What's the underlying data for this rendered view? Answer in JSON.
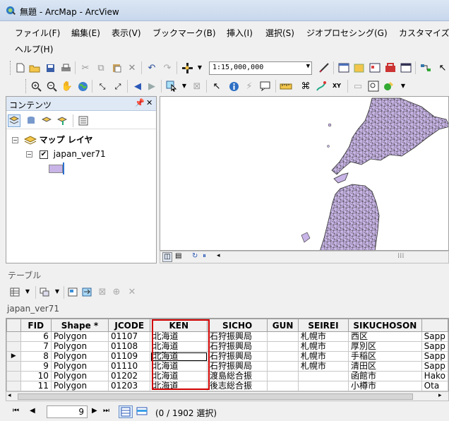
{
  "window": {
    "title": "無題 - ArcMap - ArcView"
  },
  "menu": [
    {
      "label": "ファイル(F)"
    },
    {
      "label": "編集(E)"
    },
    {
      "label": "表示(V)"
    },
    {
      "label": "ブックマーク(B)"
    },
    {
      "label": "挿入(I)"
    },
    {
      "label": "選択(S)"
    },
    {
      "label": "ジオプロセシング(G)"
    },
    {
      "label": "カスタマイズ"
    },
    {
      "label": "ヘルプ(H)"
    }
  ],
  "toolbar": {
    "scale_value": "1:15,000,000"
  },
  "contents": {
    "title": "コンテンツ",
    "pin_icon": "pin-icon",
    "close_icon": "close-icon",
    "layers_group": "マップ レイヤ",
    "layer_name": "japan_ver71",
    "layer_visible": true,
    "symbol_color": "#c8b4e6"
  },
  "map": {
    "fill_color": "#c8b4e6",
    "stroke_color": "#333333"
  },
  "table": {
    "panel_title": "テーブル",
    "layer_name": "japan_ver71",
    "columns": [
      "FID",
      "Shape *",
      "JCODE",
      "KEN",
      "SICHO",
      "GUN",
      "SEIREI",
      "SIKUCHOSON",
      ""
    ],
    "rows": [
      {
        "fid": "6",
        "shape": "Polygon",
        "jcode": "01107",
        "ken": "北海道",
        "sicho": "石狩振興局",
        "gun": "",
        "seirei": "札幌市",
        "sikuchoson": "西区",
        "extra": "Sapp"
      },
      {
        "fid": "7",
        "shape": "Polygon",
        "jcode": "01108",
        "ken": "北海道",
        "sicho": "石狩振興局",
        "gun": "",
        "seirei": "札幌市",
        "sikuchoson": "厚別区",
        "extra": "Sapp"
      },
      {
        "fid": "8",
        "shape": "Polygon",
        "jcode": "01109",
        "ken": "北海道",
        "sicho": "石狩振興局",
        "gun": "",
        "seirei": "札幌市",
        "sikuchoson": "手稲区",
        "extra": "Sapp"
      },
      {
        "fid": "9",
        "shape": "Polygon",
        "jcode": "01110",
        "ken": "北海道",
        "sicho": "石狩振興局",
        "gun": "",
        "seirei": "札幌市",
        "sikuchoson": "清田区",
        "extra": "Sapp"
      },
      {
        "fid": "10",
        "shape": "Polygon",
        "jcode": "01202",
        "ken": "北海道",
        "sicho": "渡島総合振",
        "gun": "",
        "seirei": "",
        "sikuchoson": "函館市",
        "extra": "Hako"
      },
      {
        "fid": "11",
        "shape": "Polygon",
        "jcode": "01203",
        "ken": "北海道",
        "sicho": "後志総合振",
        "gun": "",
        "seirei": "",
        "sikuchoson": "小樽市",
        "extra": "Ota"
      }
    ],
    "current_row_marker": "▶",
    "highlight_color": "#d00000"
  },
  "status": {
    "record": "9",
    "selection": "(0 / 1902 選択)"
  }
}
